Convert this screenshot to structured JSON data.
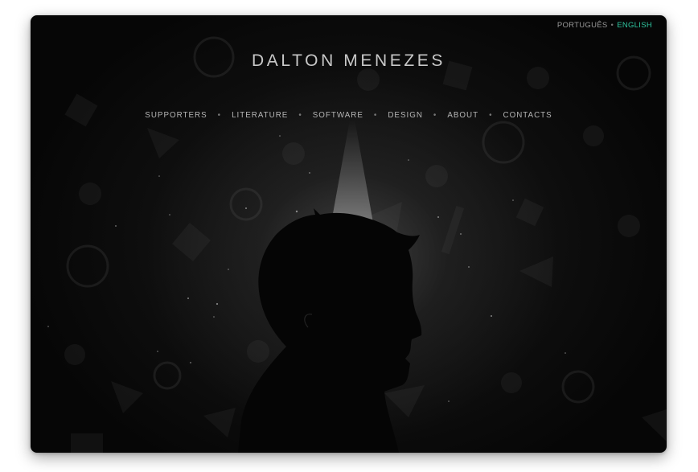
{
  "language_switcher": {
    "portuguese": "PORTUGUÊS",
    "separator": "•",
    "english": "ENGLISH",
    "active_color": "#2fc7a0"
  },
  "site": {
    "title": "DALTON MENEZES"
  },
  "nav": {
    "separator": "•",
    "items": [
      {
        "label": "SUPPORTERS"
      },
      {
        "label": "LITERATURE"
      },
      {
        "label": "SOFTWARE"
      },
      {
        "label": "DESIGN"
      },
      {
        "label": "ABOUT"
      },
      {
        "label": "CONTACTS"
      }
    ]
  },
  "hero": {
    "image": "head-silhouette-icon",
    "background_color": "#060606"
  }
}
